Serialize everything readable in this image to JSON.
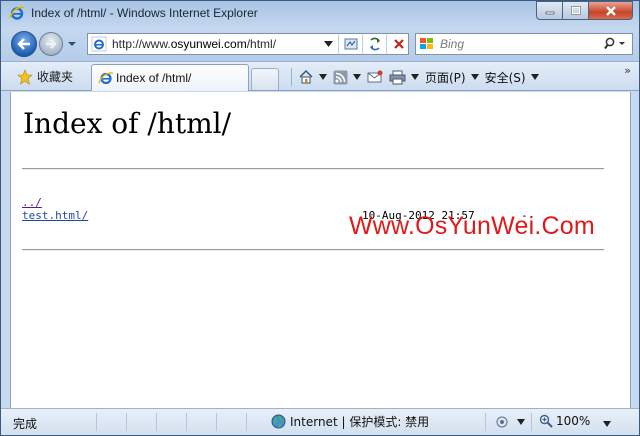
{
  "window": {
    "title": "Index of /html/ - Windows Internet Explorer",
    "controls": [
      "minimize",
      "maximize",
      "close"
    ]
  },
  "address_bar": {
    "prefix": "http://www.",
    "host": "osyunwei.com",
    "path": "/html/",
    "icon": "ie-page-icon"
  },
  "search": {
    "placeholder": "Bing",
    "icon": "search-icon"
  },
  "favorites": {
    "label": "收藏夹",
    "icon": "star-icon"
  },
  "tab": {
    "label": "Index of /html/"
  },
  "commands": {
    "page_label": "页面(P)",
    "safety_label": "安全(S)",
    "icons": [
      "home-icon",
      "rss-icon",
      "mail-icon",
      "print-icon"
    ]
  },
  "page": {
    "heading": "Index of /html/",
    "entries": [
      {
        "name": "../",
        "date": "",
        "size": ""
      },
      {
        "name": "test.html/",
        "date": "10-Aug-2012 21:57",
        "size": "-"
      }
    ],
    "watermark": "Www.OsYunWei.Com"
  },
  "status": {
    "text": "完成",
    "zone": "Internet | 保护模式: 禁用",
    "zoom": "100%"
  },
  "colors": {
    "visited_link": "#551a8b",
    "link": "#1a4aa8",
    "watermark": "#e01a1a"
  }
}
